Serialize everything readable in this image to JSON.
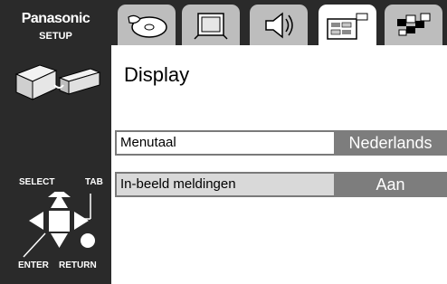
{
  "brand": {
    "name": "Panasonic",
    "subtitle": "SETUP"
  },
  "tabs": [
    {
      "icon": "disc-icon",
      "active": false
    },
    {
      "icon": "display-monitor-icon",
      "active": false
    },
    {
      "icon": "speaker-audio-icon",
      "active": false
    },
    {
      "icon": "display-settings-icon",
      "active": true
    },
    {
      "icon": "other-settings-icon",
      "active": false
    }
  ],
  "page": {
    "title": "Display"
  },
  "settings": [
    {
      "label": "Menutaal",
      "value": "Nederlands",
      "selected": false
    },
    {
      "label": "In-beeld meldingen",
      "value": "Aan",
      "selected": true
    }
  ],
  "controls": {
    "select": "SELECT",
    "tab": "TAB",
    "enter": "ENTER",
    "return": "RETURN"
  },
  "colors": {
    "sidebar": "#2a2a2a",
    "value_bg": "#7d7d7d",
    "tab_inactive": "#bdbdbd",
    "selected_row": "#d9d9d9"
  }
}
